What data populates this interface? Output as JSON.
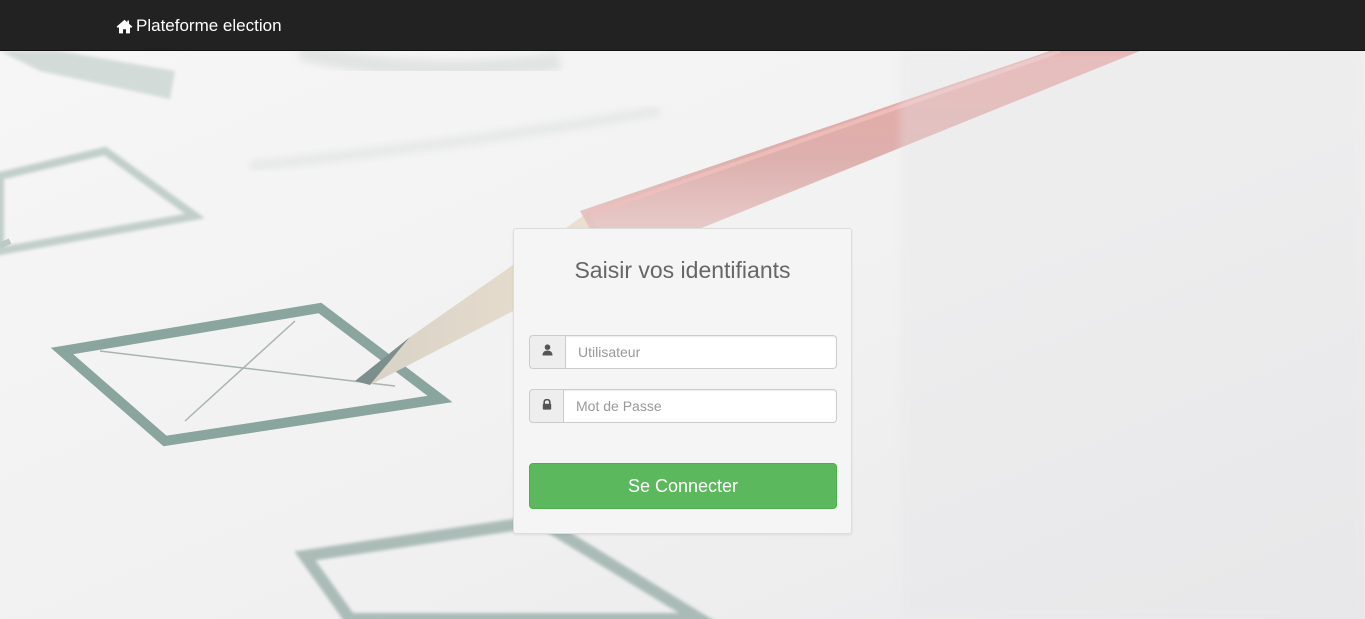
{
  "colors": {
    "navbar_bg": "#222222",
    "brand_text": "#ffffff",
    "panel_bg": "#f5f5f5",
    "button_bg": "#5cb85c",
    "title_text": "#666666"
  },
  "navbar": {
    "brand_icon": "home-icon",
    "brand_label": "Plateforme election"
  },
  "login": {
    "title": "Saisir vos identifiants",
    "username": {
      "icon": "user-icon",
      "placeholder": "Utilisateur",
      "value": ""
    },
    "password": {
      "icon": "lock-icon",
      "placeholder": "Mot de Passe",
      "value": ""
    },
    "submit_label": "Se Connecter"
  }
}
